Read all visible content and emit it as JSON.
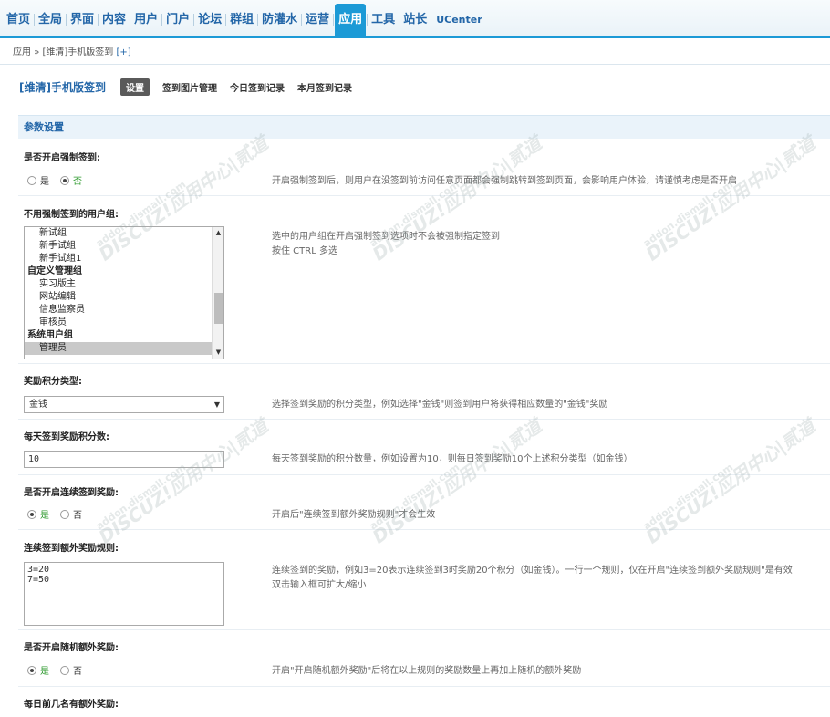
{
  "nav": {
    "items": [
      "首页",
      "全局",
      "界面",
      "内容",
      "用户",
      "门户",
      "论坛",
      "群组",
      "防灌水",
      "运营",
      "应用",
      "工具",
      "站长"
    ],
    "active": "应用",
    "ucenter": "UCenter"
  },
  "breadcrumb": {
    "root": "应用",
    "sep": "»",
    "current": "[维清]手机版签到",
    "add": "[+]"
  },
  "plugin": {
    "title": "[维清]手机版签到",
    "tabs": [
      "设置",
      "签到图片管理",
      "今日签到记录",
      "本月签到记录"
    ],
    "active_tab": "设置"
  },
  "section": {
    "title": "参数设置"
  },
  "rows": {
    "force": {
      "title": "是否开启强制签到:",
      "yes": "是",
      "no": "否",
      "selected": "否",
      "hint": "开启强制签到后，则用户在没签到前访问任意页面都会强制跳转到签到页面，会影响用户体验，请谨慎考虑是否开启"
    },
    "groups": {
      "title": "不用强制签到的用户组:",
      "options": [
        {
          "label": "新试组",
          "group": false,
          "selected": false
        },
        {
          "label": "新手试组",
          "group": false,
          "selected": false
        },
        {
          "label": "新手试组1",
          "group": false,
          "selected": false
        },
        {
          "label": "自定义管理组",
          "group": true,
          "selected": false
        },
        {
          "label": "实习版主",
          "group": false,
          "selected": false
        },
        {
          "label": "网站编辑",
          "group": false,
          "selected": false
        },
        {
          "label": "信息监察员",
          "group": false,
          "selected": false
        },
        {
          "label": "审核员",
          "group": false,
          "selected": false
        },
        {
          "label": "系统用户组",
          "group": true,
          "selected": false
        },
        {
          "label": "管理员",
          "group": false,
          "selected": true
        }
      ],
      "hint1": "选中的用户组在开启强制签到选项时不会被强制指定签到",
      "hint2": "按住 CTRL 多选"
    },
    "credit_type": {
      "title": "奖励积分类型:",
      "value": "金钱",
      "hint": "选择签到奖励的积分类型，例如选择\"金钱\"则签到用户将获得相应数量的\"金钱\"奖励"
    },
    "daily_credit": {
      "title": "每天签到奖励积分数:",
      "value": "10",
      "hint": "每天签到奖励的积分数量，例如设置为10，则每日签到奖励10个上述积分类型（如金钱）"
    },
    "continuous": {
      "title": "是否开启连续签到奖励:",
      "yes": "是",
      "no": "否",
      "selected": "是",
      "hint": "开启后\"连续签到额外奖励规则\"才会生效"
    },
    "continuous_rules": {
      "title": "连续签到额外奖励规则:",
      "value": "3=20\n7=50",
      "hint1": "连续签到的奖励，例如3=20表示连续签到3时奖励20个积分（如金钱）。一行一个规则，仅在开启\"连续签到额外奖励规则\"是有效",
      "hint2": "双击输入框可扩大/缩小"
    },
    "random": {
      "title": "是否开启随机额外奖励:",
      "yes": "是",
      "no": "否",
      "selected": "是",
      "hint": "开启\"开启随机额外奖励\"后将在以上规则的奖励数量上再加上随机的额外奖励"
    },
    "top_n": {
      "title": "每日前几名有额外奖励:"
    }
  },
  "watermark": {
    "line1": "DISCUZ!应用中心|贰道",
    "line2": "addon.dismall.com"
  },
  "colors": {
    "accent": "#1c9ad6",
    "link": "#2366a8",
    "selected_radio": "#2e9a2e"
  }
}
